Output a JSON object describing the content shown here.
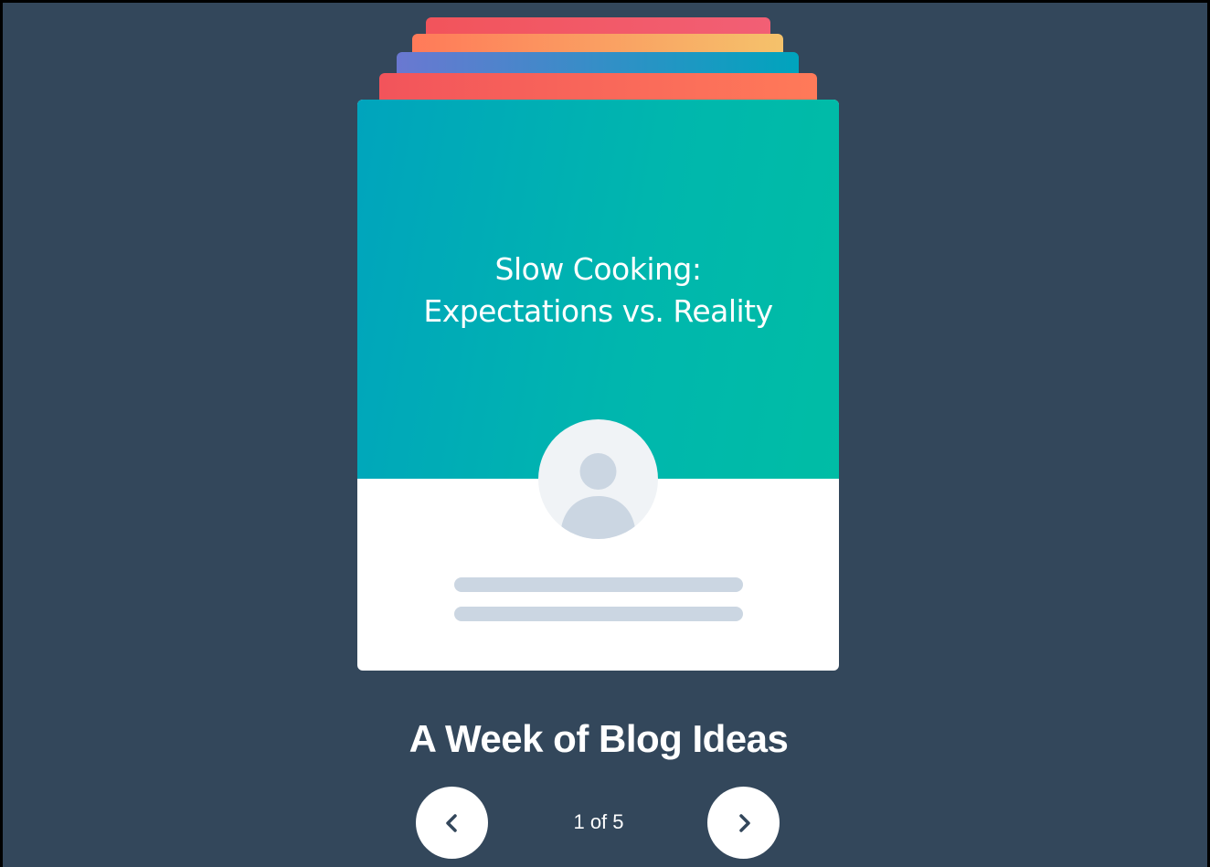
{
  "card": {
    "title_line1": "Slow Cooking:",
    "title_line2": "Expectations vs. Reality",
    "avatar_icon": "user-avatar-icon",
    "stack_colors": [
      "#f2545b",
      "#ff7a59",
      "#6a78d1",
      "#f2545b"
    ],
    "top_color": "#00a4bd",
    "placeholder_line_color": "#cbd6e2"
  },
  "heading": "A Week of Blog Ideas",
  "pagination": {
    "text": "1 of 5",
    "current": 1,
    "total": 5,
    "prev_icon": "chevron-left-icon",
    "next_icon": "chevron-right-icon"
  },
  "colors": {
    "background": "#33475b",
    "accent": "#00bda5"
  }
}
